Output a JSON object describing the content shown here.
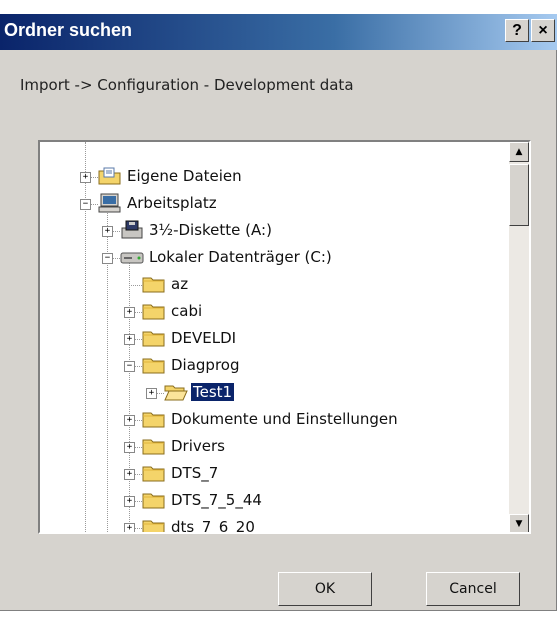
{
  "window": {
    "title": "Ordner suchen",
    "help_label": "?",
    "close_label": "×"
  },
  "description": "Import -> Configuration - Development data",
  "tree": {
    "items": [
      {
        "label": "Eigene Dateien",
        "icon": "my-documents-icon",
        "expander": "+",
        "selected": false
      },
      {
        "label": "Arbeitsplatz",
        "icon": "computer-icon",
        "expander": "−",
        "selected": false
      },
      {
        "label": "3½-Diskette (A:)",
        "icon": "floppy-drive-icon",
        "expander": "+",
        "selected": false
      },
      {
        "label": "Lokaler Datenträger (C:)",
        "icon": "hard-drive-icon",
        "expander": "−",
        "selected": false
      },
      {
        "label": "az",
        "icon": "folder-icon",
        "expander": "",
        "selected": false
      },
      {
        "label": "cabi",
        "icon": "folder-icon",
        "expander": "+",
        "selected": false
      },
      {
        "label": "DEVELDI",
        "icon": "folder-icon",
        "expander": "+",
        "selected": false
      },
      {
        "label": "Diagprog",
        "icon": "folder-icon",
        "expander": "−",
        "selected": false
      },
      {
        "label": "Test1",
        "icon": "open-folder-icon",
        "expander": "+",
        "selected": true
      },
      {
        "label": "Dokumente und Einstellungen",
        "icon": "folder-icon",
        "expander": "+",
        "selected": false
      },
      {
        "label": "Drivers",
        "icon": "folder-icon",
        "expander": "+",
        "selected": false
      },
      {
        "label": "DTS_7",
        "icon": "folder-icon",
        "expander": "+",
        "selected": false
      },
      {
        "label": "DTS_7_5_44",
        "icon": "folder-icon",
        "expander": "+",
        "selected": false
      },
      {
        "label": "dts_7_6_20",
        "icon": "folder-icon",
        "expander": "+",
        "selected": false
      }
    ]
  },
  "scrollbar": {
    "up_arrow": "▲",
    "down_arrow": "▼"
  },
  "buttons": {
    "ok": "OK",
    "cancel": "Cancel"
  },
  "colors": {
    "titlebar": "#0a246a",
    "selection": "#0a246a",
    "face": "#d6d3ce"
  }
}
